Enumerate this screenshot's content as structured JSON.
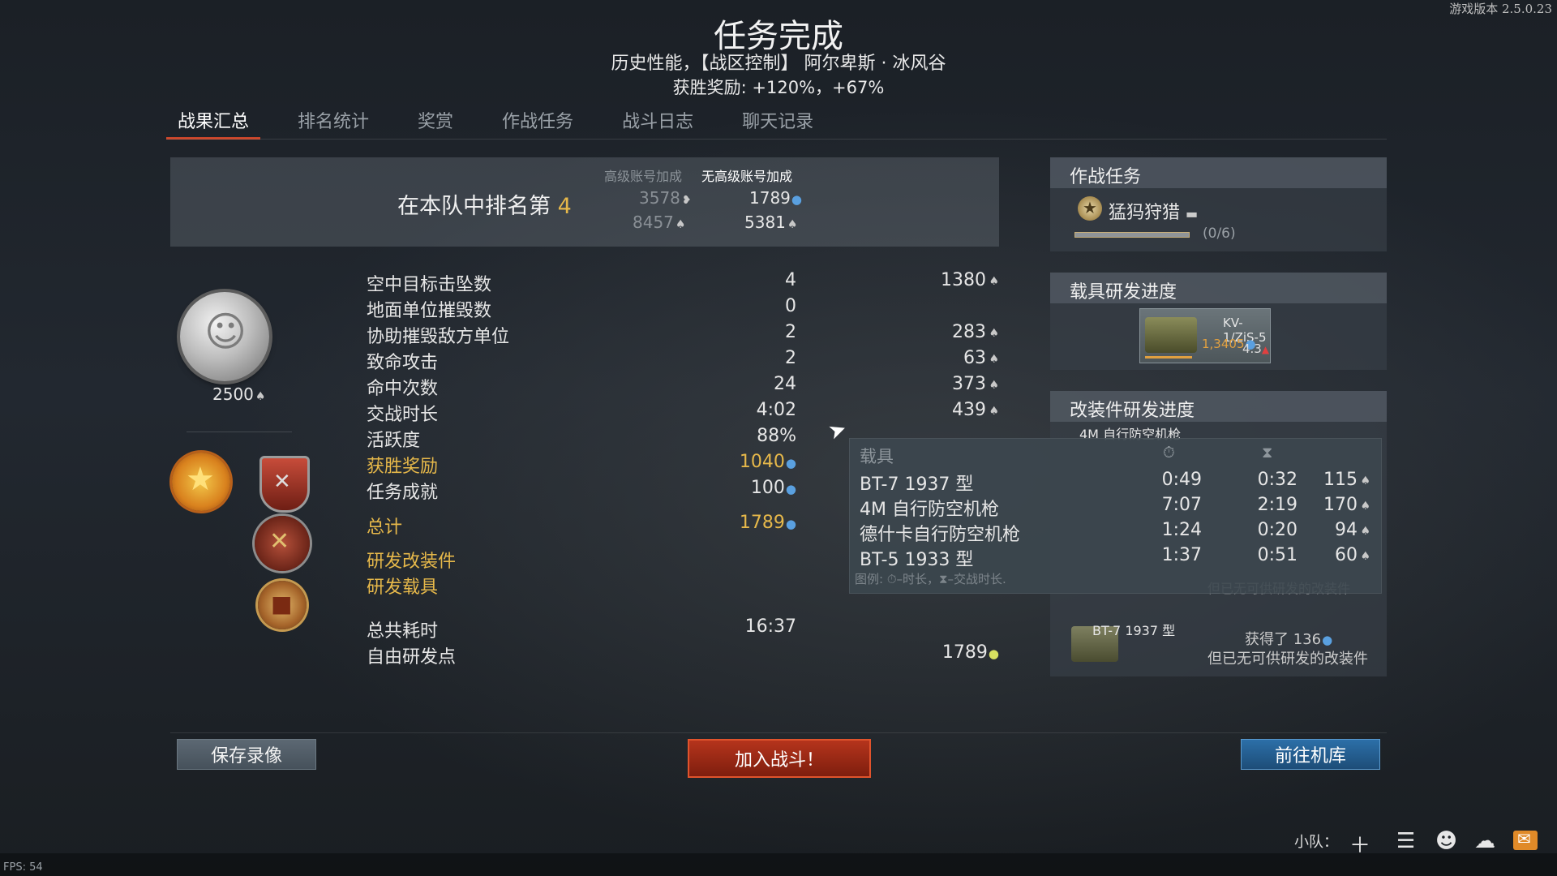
{
  "version": "游戏版本 2.5.0.23",
  "header": {
    "title": "任务完成",
    "subtitle": "历史性能，【战区控制】 阿尔卑斯 · 冰风谷",
    "bonus": "获胜奖励: +120%，+67%"
  },
  "tabs": [
    "战果汇总",
    "排名统计",
    "奖赏",
    "作战任务",
    "战斗日志",
    "聊天记录"
  ],
  "rank": {
    "text": "在本队中排名第",
    "place": "4",
    "premium_header": "高级账号加成",
    "nopremium_header": "无高级账号加成",
    "premium_rp": "3578",
    "nopremium_rp": "1789",
    "premium_sl": "8457",
    "nopremium_sl": "5381"
  },
  "coin_value": "2500",
  "stats": [
    {
      "label": "空中目标击坠数",
      "count": "4",
      "reward": "1380"
    },
    {
      "label": "地面单位摧毁数",
      "count": "0",
      "reward": ""
    },
    {
      "label": "协助摧毁敌方单位",
      "count": "2",
      "reward": "283"
    },
    {
      "label": "致命攻击",
      "count": "2",
      "reward": "63"
    },
    {
      "label": "命中次数",
      "count": "24",
      "reward": "373"
    },
    {
      "label": "交战时长",
      "count": "4:02",
      "reward": "439"
    },
    {
      "label": "活跃度",
      "count": "88%",
      "reward": ""
    },
    {
      "label": "获胜奖励",
      "count": "1040",
      "reward": ""
    },
    {
      "label": "任务成就",
      "count": "100",
      "reward": ""
    }
  ],
  "totals": {
    "total_label": "总计",
    "total_value": "1789",
    "research_mods": "研发改装件",
    "research_vehicles": "研发载具",
    "total_time_label": "总共耗时",
    "total_time": "16:37",
    "free_rp_label": "自由研发点",
    "free_rp": "1789"
  },
  "missions": {
    "header": "作战任务",
    "name": "猛犸狩猎",
    "progress_text": "(0/6)",
    "progress": 0
  },
  "vehicle_research": {
    "header": "载具研发进度",
    "vehicle": "KV-1/ZiS-5",
    "rp": "1,3405",
    "br": "4.3"
  },
  "mod_research": {
    "header": "改装件研发进度",
    "first_item": "4M 自行防空机枪",
    "bt7_name": "BT-7 1937 型",
    "bt7_gain": "获得了 136",
    "bt7_note": "但已无可供研发的改装件",
    "hidden_note": "但已无可供研发的改装件"
  },
  "tooltip": {
    "col_vehicle": "载具",
    "rows": [
      {
        "name": "BT-7 1937 型",
        "time": "0:49",
        "combat": "0:32",
        "sl": "115"
      },
      {
        "name": "4M 自行防空机枪",
        "time": "7:07",
        "combat": "2:19",
        "sl": "170"
      },
      {
        "name": "德什卡自行防空机枪",
        "time": "1:24",
        "combat": "0:20",
        "sl": "94"
      },
      {
        "name": "BT-5 1933 型",
        "time": "1:37",
        "combat": "0:51",
        "sl": "60"
      }
    ],
    "legend": "图例: ⏱–时长，⧗–交战时长."
  },
  "buttons": {
    "save_replay": "保存录像",
    "join_battle": "加入战斗！",
    "go_hangar": "前往机库"
  },
  "status": {
    "squad_label": "小队：",
    "fps": "FPS: 54"
  }
}
